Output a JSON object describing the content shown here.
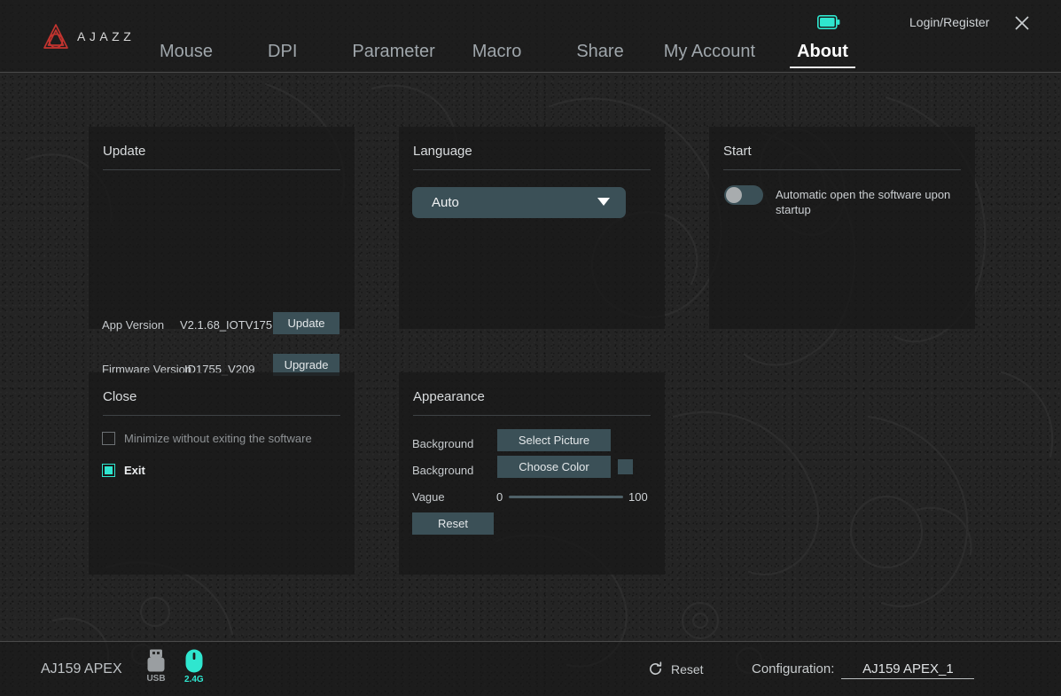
{
  "header": {
    "brand": "AJAZZ",
    "nav": [
      {
        "label": "Mouse",
        "active": false
      },
      {
        "label": "DPI",
        "active": false
      },
      {
        "label": "Parameter",
        "active": false
      },
      {
        "label": "Macro",
        "active": false
      },
      {
        "label": "Share",
        "active": false
      },
      {
        "label": "My Account",
        "active": false
      },
      {
        "label": "About",
        "active": true
      }
    ],
    "login_label": "Login/Register",
    "battery_icon": "battery-icon",
    "close_icon": "close-icon"
  },
  "cards": {
    "update": {
      "title": "Update",
      "app_version_label": "App Version",
      "app_version_value": "V2.1.68_IOTV175",
      "update_button": "Update",
      "firmware_version_label": "Firmware Version",
      "firmware_version_value": "ID1755_V209",
      "upgrade_button": "Upgrade"
    },
    "language": {
      "title": "Language",
      "selected": "Auto",
      "options": [
        "Auto"
      ]
    },
    "start": {
      "title": "Start",
      "toggle_state": "off",
      "toggle_label": "Automatic open the software upon startup"
    },
    "close": {
      "title": "Close",
      "minimize_label": "Minimize without exiting the software",
      "minimize_checked": false,
      "exit_label": "Exit",
      "exit_checked": true
    },
    "appearance": {
      "title": "Appearance",
      "background_picture_label": "Background",
      "select_picture_button": "Select Picture",
      "background_color_label": "Background",
      "choose_color_button": "Choose Color",
      "swatch_color": "#3b5057",
      "vague_label": "Vague",
      "vague_min": "0",
      "vague_max": "100",
      "vague_value": 0,
      "reset_button": "Reset"
    }
  },
  "status_bar": {
    "device_name": "AJ159 APEX",
    "connections": [
      {
        "label": "USB",
        "icon": "usb-icon",
        "active": false
      },
      {
        "label": "2.4G",
        "icon": "mouse-icon",
        "active": true
      }
    ],
    "reset_label": "Reset",
    "configuration_label": "Configuration:",
    "configuration_value": "AJ159 APEX_1"
  },
  "colors": {
    "accent_teal": "#2fe6cf",
    "brand_red": "#c2342f",
    "button_slate": "#3b5057",
    "app_background": "#242424"
  }
}
